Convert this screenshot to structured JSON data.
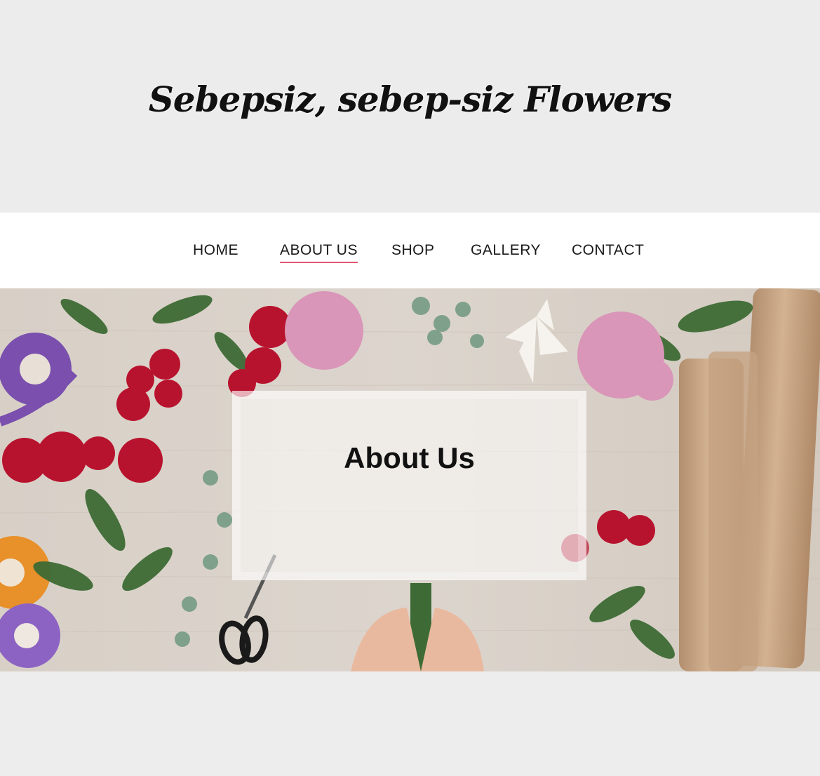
{
  "header": {
    "site_title": "Sebepsiz, sebep-siz Flowers"
  },
  "nav": {
    "items": [
      {
        "label": "HOME"
      },
      {
        "label": "ABOUT US",
        "active": true
      },
      {
        "label": "SHOP"
      },
      {
        "label": "GALLERY"
      },
      {
        "label": "CONTACT"
      }
    ]
  },
  "hero": {
    "title": "About Us"
  },
  "colors": {
    "accent": "#e0566f",
    "nav_background": "#ffffff",
    "page_background": "#ededed"
  }
}
